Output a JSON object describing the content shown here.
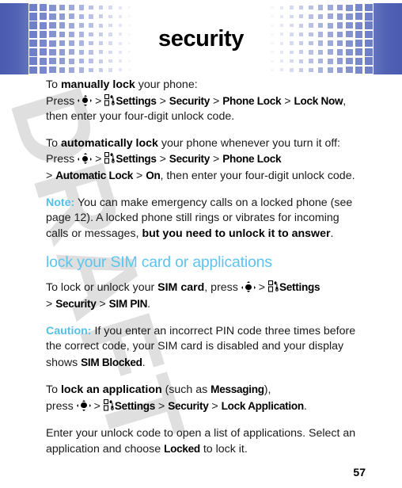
{
  "page": {
    "title": "security",
    "page_number": "57",
    "watermark": "DRAFT"
  },
  "colors": {
    "header_blue": "#4a5bb0",
    "grid_square": "#6f7fc8",
    "note_blue": "#54c0ea",
    "heading_blue": "#5bc4ef",
    "body_text": "#1a1a1a",
    "watermark_gray": "#d8d8d8"
  },
  "icons": {
    "nav_key": "navigation-key-icon",
    "settings": "settings-menu-icon"
  },
  "body": {
    "p1": {
      "t1": "To ",
      "b1": "manually lock",
      "t2": " your phone:",
      "t3": "Press ",
      "sep1": " > ",
      "m1": "Settings",
      "sep2": " > ",
      "m2": "Security",
      "sep3": " > ",
      "m3": "Phone Lock",
      "sep4": " > ",
      "m4": "Lock Now",
      "t4": ", then enter your four-digit unlock code."
    },
    "p2": {
      "t1": "To ",
      "b1": "automatically lock",
      "t2": " your phone whenever you turn it off: Press ",
      "sep1": " > ",
      "m1": "Settings",
      "sep2": " > ",
      "m2": "Security",
      "sep3": " > ",
      "m3": "Phone Lock",
      "sep4": " > ",
      "m4": "Automatic Lock",
      "sep5": " > ",
      "m5": "On",
      "t3": ", then enter your four-digit unlock code."
    },
    "note": {
      "label": "Note:",
      "t1": " You can make emergency calls on a locked phone (see page 12). A locked phone still rings or vibrates for incoming calls or messages, ",
      "b1": "but you need to unlock it to answer",
      "t2": "."
    },
    "section_heading": "lock your SIM card or applications",
    "p3": {
      "t1": "To lock or unlock your ",
      "b1": "SIM card",
      "t2": ", press ",
      "sep1": " > ",
      "m1": "Settings",
      "sep2": " > ",
      "m2": "Security",
      "sep3": " > ",
      "m3": "SIM PIN",
      "t3": "."
    },
    "caution": {
      "label": "Caution:",
      "t1": " If you enter an incorrect PIN code three times before the correct code, your SIM card is disabled and your display shows ",
      "m1": "SIM Blocked",
      "t2": "."
    },
    "p4": {
      "t1": "To ",
      "b1": "lock an application",
      "t2": " (such as ",
      "m0": "Messaging",
      "t3": "),",
      "t4": "press ",
      "sep1": " > ",
      "m1": "Settings",
      "sep2": " > ",
      "m2": "Security",
      "sep3": " > ",
      "m3": "Lock Application",
      "t5": "."
    },
    "p5": {
      "t1": "Enter your unlock code to open a list of applications. Select an application and choose ",
      "m1": "Locked",
      "t2": " to lock it."
    }
  }
}
